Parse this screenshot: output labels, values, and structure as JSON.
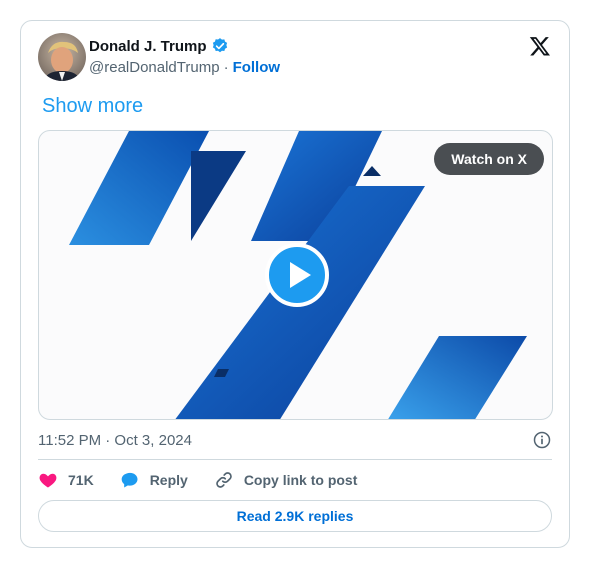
{
  "author": {
    "name": "Donald J. Trump",
    "handle": "@realDonaldTrump",
    "separator": "·",
    "follow_label": "Follow"
  },
  "tweet": {
    "show_more_label": "Show more",
    "timestamp": "11:52 PM · Oct 3, 2024"
  },
  "media": {
    "watch_label": "Watch on X"
  },
  "actions": {
    "likes": "71K",
    "reply_label": "Reply",
    "copy_link_label": "Copy link to post"
  },
  "replies_button": "Read 2.9K replies",
  "icons": {
    "verified": "verified-badge-icon",
    "logo": "x-logo-icon",
    "play": "play-icon",
    "info": "info-icon",
    "heart": "heart-icon",
    "reply": "reply-bubble-icon",
    "link": "link-icon"
  },
  "colors": {
    "accent": "#1d9bf0",
    "link_blue": "#006fd6",
    "heart": "#f91880",
    "muted": "#536471",
    "border": "#cfd9de"
  }
}
